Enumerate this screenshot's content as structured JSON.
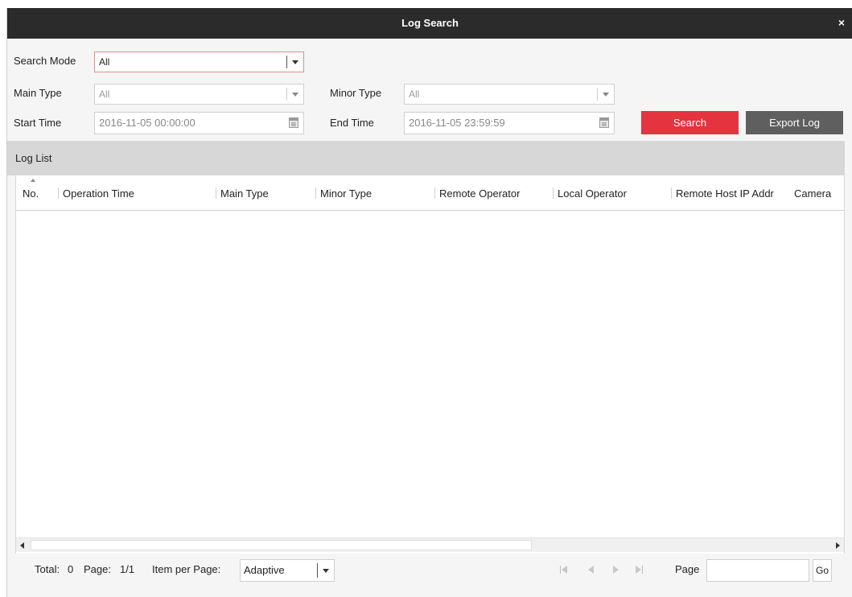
{
  "window": {
    "title": "Log Search",
    "close_label": "×"
  },
  "filters": {
    "search_mode_label": "Search Mode",
    "search_mode_value": "All",
    "main_type_label": "Main Type",
    "main_type_value": "All",
    "minor_type_label": "Minor Type",
    "minor_type_value": "All",
    "start_time_label": "Start Time",
    "start_time_value": "2016-11-05 00:00:00",
    "end_time_label": "End Time",
    "end_time_value": "2016-11-05 23:59:59"
  },
  "buttons": {
    "search": "Search",
    "export_log": "Export Log"
  },
  "log_list": {
    "title": "Log List",
    "columns": [
      "No.",
      "Operation Time",
      "Main Type",
      "Minor Type",
      "Remote Operator",
      "Local Operator",
      "Remote Host IP Addr",
      "Camera"
    ],
    "rows": []
  },
  "pagination": {
    "total_label": "Total:",
    "total_value": "0",
    "page_label": "Page:",
    "page_value": "1/1",
    "items_per_page_label": "Item per Page:",
    "items_per_page_value": "Adaptive",
    "goto_label": "Page",
    "goto_value": "",
    "go_label": "Go"
  },
  "colors": {
    "accent_red": "#e3343f",
    "titlebar": "#2b2b2b",
    "export_button": "#5f5f5f"
  },
  "icons": [
    "close-icon",
    "dropdown-arrow-icon",
    "calendar-icon",
    "sort-icon",
    "first-page-icon",
    "prev-page-icon",
    "next-page-icon",
    "last-page-icon"
  ]
}
